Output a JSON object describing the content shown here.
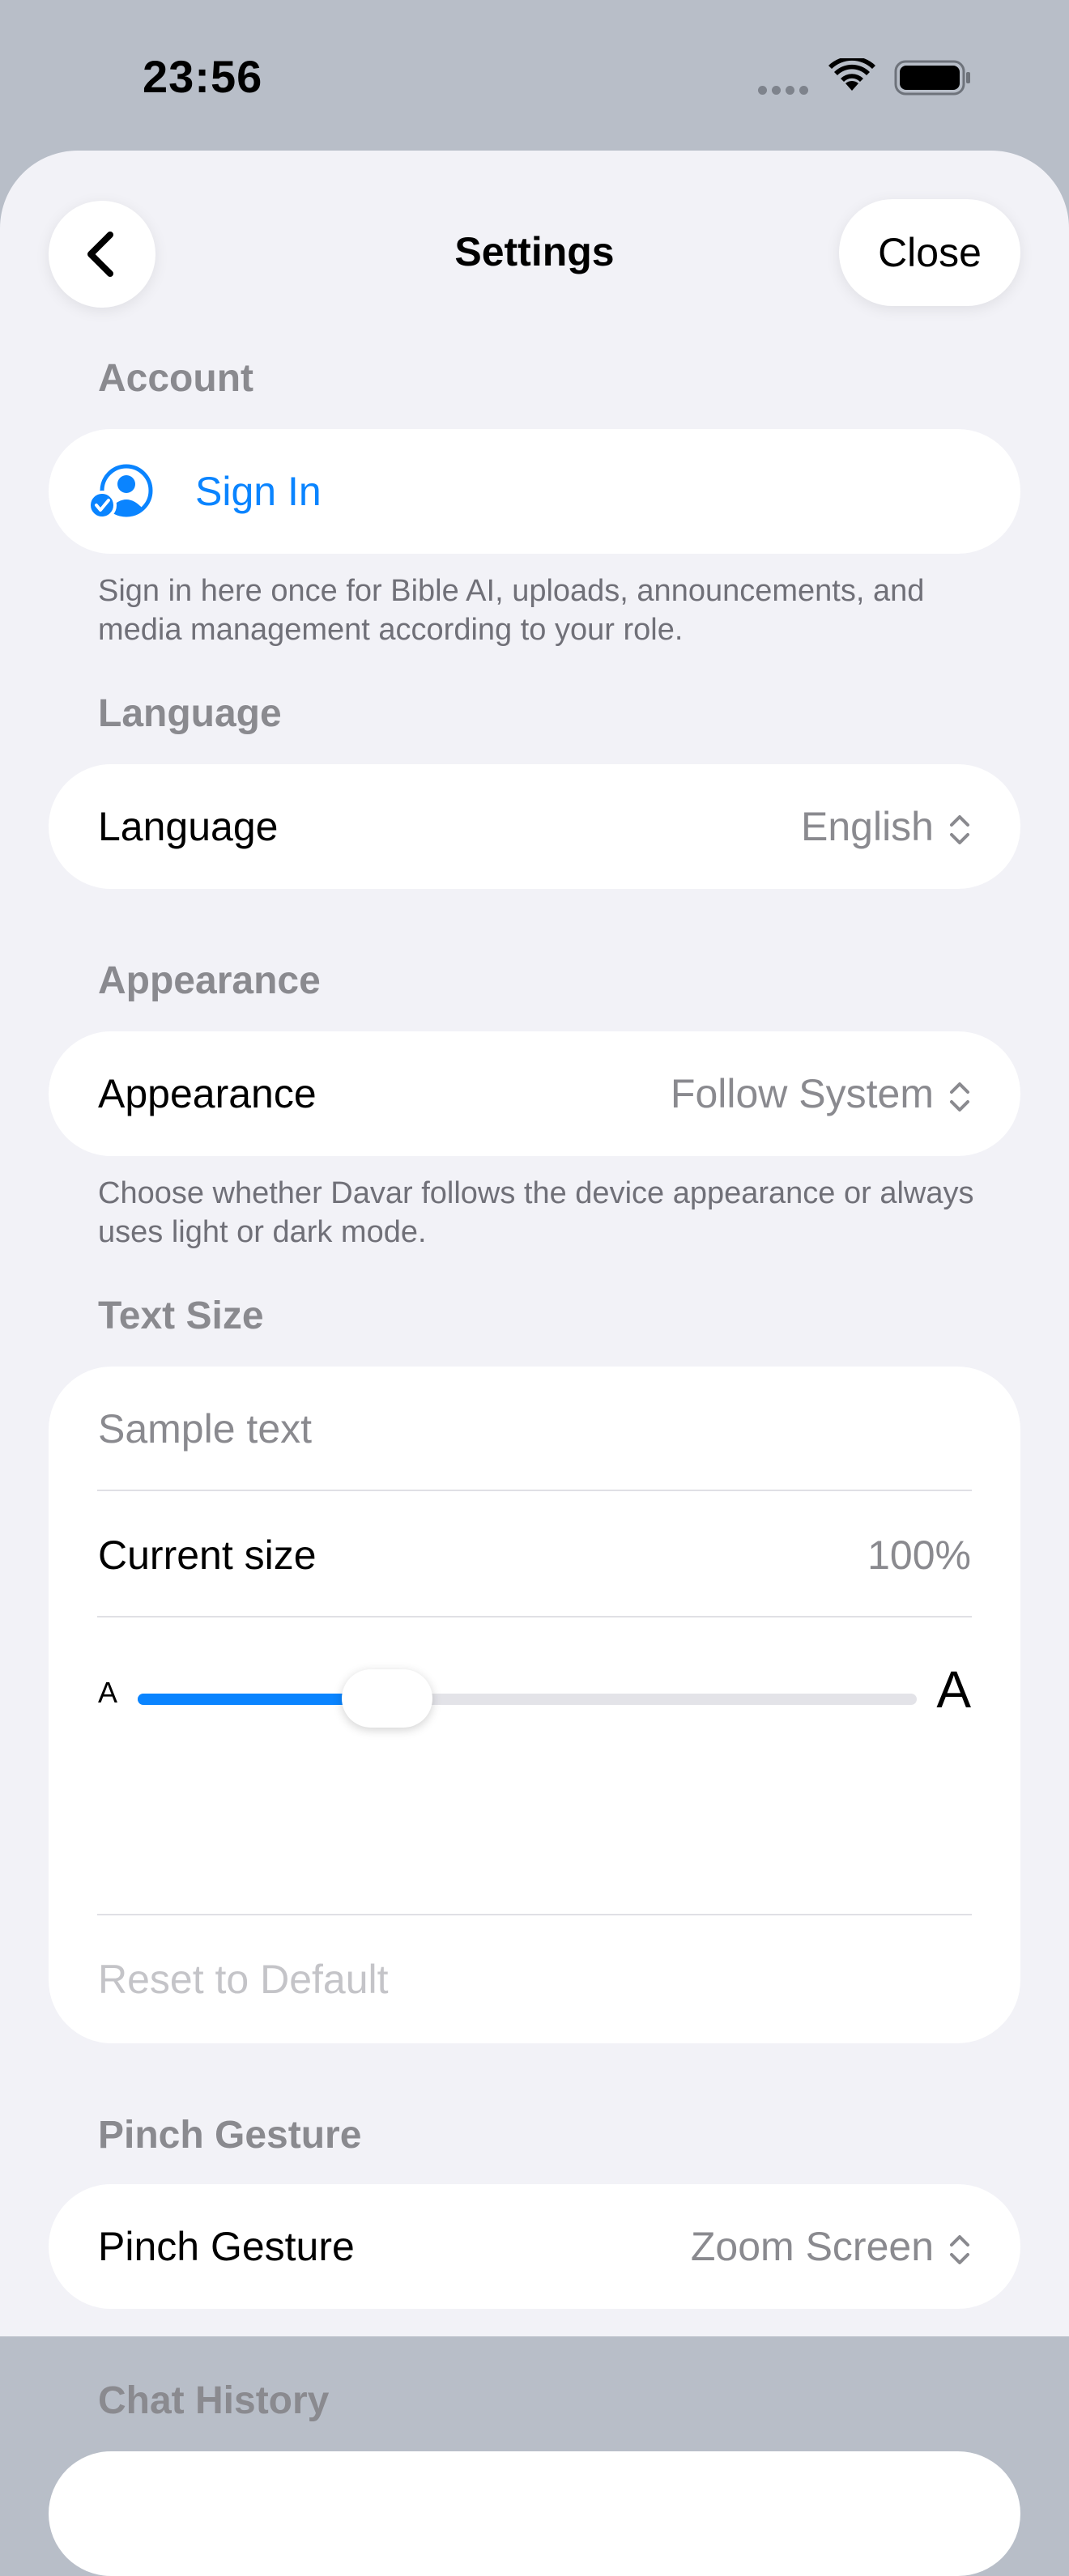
{
  "status_bar": {
    "time": "23:56"
  },
  "header": {
    "title": "Settings",
    "close_label": "Close"
  },
  "sections": {
    "account": {
      "heading": "Account",
      "sign_in_label": "Sign In",
      "footnote": "Sign in here once for Bible AI, uploads, announcements, and media management according to your role."
    },
    "language": {
      "heading": "Language",
      "label": "Language",
      "value": "English"
    },
    "appearance": {
      "heading": "Appearance",
      "label": "Appearance",
      "value": "Follow System",
      "footnote": "Choose whether Davar follows the device appearance or always uses light or dark mode."
    },
    "text_size": {
      "heading": "Text Size",
      "sample": "Sample text",
      "current_label": "Current size",
      "current_value": "100%",
      "small_a": "A",
      "large_a": "A",
      "slider_fraction": 0.32,
      "reset_label": "Reset to Default"
    },
    "pinch": {
      "heading": "Pinch Gesture",
      "label": "Pinch Gesture",
      "value": "Zoom Screen"
    },
    "chat_history": {
      "heading": "Chat History"
    }
  },
  "colors": {
    "accent": "#0a84ff",
    "background": "#f2f2f7",
    "secondary_text": "#8a8a8f"
  }
}
